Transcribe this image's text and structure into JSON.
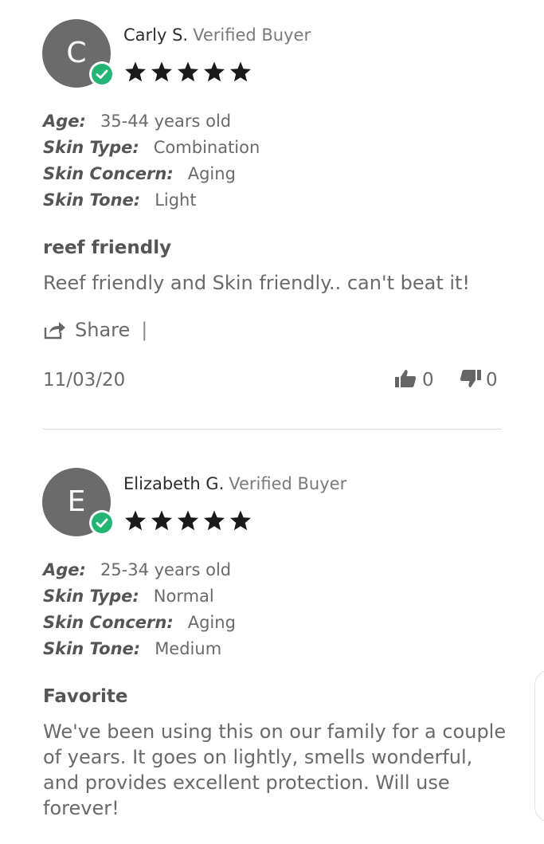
{
  "reviews": [
    {
      "initial": "C",
      "name": "Carly S.",
      "verified": "Verified Buyer",
      "rating": 5,
      "attributes": [
        {
          "key": "Age:",
          "value": "35-44 years old"
        },
        {
          "key": "Skin Type:",
          "value": "Combination"
        },
        {
          "key": "Skin Concern:",
          "value": "Aging"
        },
        {
          "key": "Skin Tone:",
          "value": "Light"
        }
      ],
      "title": "reef friendly",
      "body": "Reef friendly and Skin friendly.. can't beat it!",
      "share_label": "Share",
      "separator": "|",
      "date": "11/03/20",
      "helpful_yes": "0",
      "helpful_no": "0"
    },
    {
      "initial": "E",
      "name": "Elizabeth G.",
      "verified": "Verified Buyer",
      "rating": 5,
      "attributes": [
        {
          "key": "Age:",
          "value": "25-34 years old"
        },
        {
          "key": "Skin Type:",
          "value": "Normal"
        },
        {
          "key": "Skin Concern:",
          "value": "Aging"
        },
        {
          "key": "Skin Tone:",
          "value": "Medium"
        }
      ],
      "title": "Favorite",
      "body": "We've been using this on our family for a couple of years. It goes on lightly, smells wonderful, and provides excellent protection. Will use forever!"
    }
  ],
  "colors": {
    "verified_badge": "#22b573",
    "avatar": "#6b6b6b",
    "star": "#1a1a1a"
  },
  "icons": {
    "verified": "check-circle-icon",
    "star": "star-icon",
    "share": "share-icon",
    "thumbs_up": "thumbs-up-icon",
    "thumbs_down": "thumbs-down-icon"
  }
}
